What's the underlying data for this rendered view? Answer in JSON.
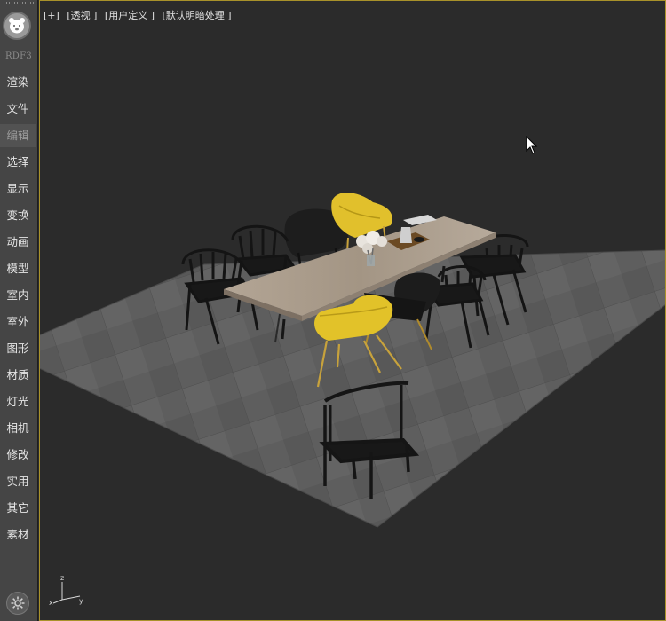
{
  "sidebar": {
    "brand": "RDF3",
    "items": [
      {
        "label": "渲染"
      },
      {
        "label": "文件"
      },
      {
        "label": "编辑",
        "active": true
      },
      {
        "label": "选择"
      },
      {
        "label": "显示"
      },
      {
        "label": "变换"
      },
      {
        "label": "动画"
      },
      {
        "label": "模型"
      },
      {
        "label": "室内"
      },
      {
        "label": "室外"
      },
      {
        "label": "图形"
      },
      {
        "label": "材质"
      },
      {
        "label": "灯光"
      },
      {
        "label": "相机"
      },
      {
        "label": "修改"
      },
      {
        "label": "实用"
      },
      {
        "label": "其它"
      },
      {
        "label": "素材"
      }
    ],
    "logo_icon": "bear-logo-icon",
    "settings_icon": "gear-icon"
  },
  "viewport": {
    "labels": {
      "plus": "[+]",
      "view": "[透视 ]",
      "shading": "[用户定义 ]",
      "lighting": "[默认明暗处理 ]"
    },
    "gizmo": {
      "x": "x",
      "y": "y",
      "z": "z"
    },
    "colors": {
      "active_border": "#a9922a",
      "background": "#2b2b2b",
      "floor": "#5c5c5c",
      "table_top": "#a89a8b",
      "yellow_chair": "#e3c22a",
      "black_chair": "#1b1b1b"
    }
  }
}
